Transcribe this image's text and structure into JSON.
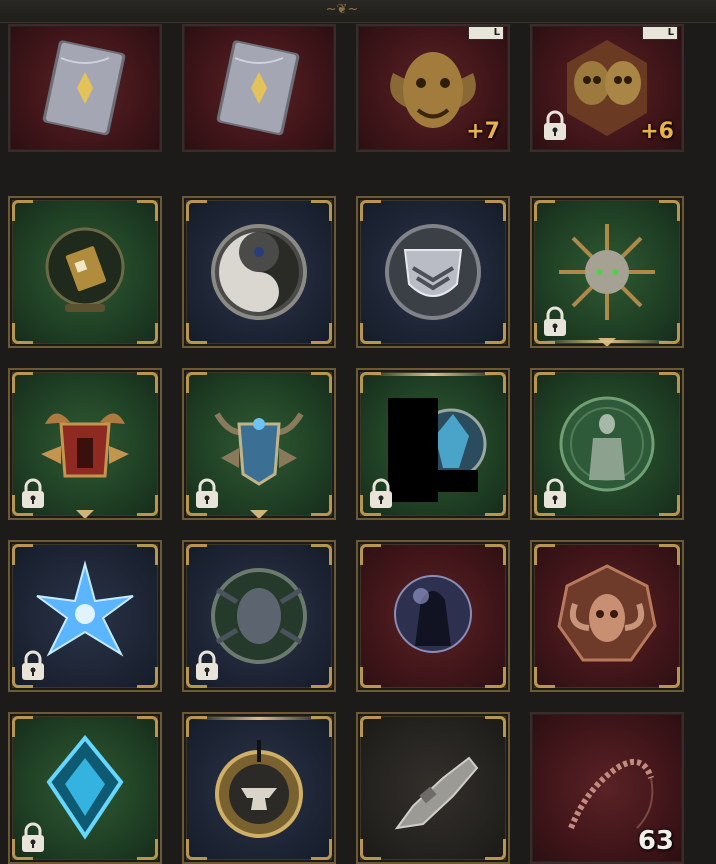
{
  "topbar": {
    "ornament": "~❦~"
  },
  "slots": [
    {
      "id": "book-1",
      "bg": "bg-red",
      "icon": "spellbook-icon",
      "count": "",
      "locked": false,
      "tier_badge": ""
    },
    {
      "id": "book-2",
      "bg": "bg-red",
      "icon": "spellbook-icon",
      "count": "",
      "locked": false,
      "tier_badge": ""
    },
    {
      "id": "ram-demon-head",
      "bg": "bg-red",
      "icon": "ram-demon-head-icon",
      "count": "+7",
      "locked": false,
      "tier_badge": "L"
    },
    {
      "id": "twin-skulls",
      "bg": "bg-red",
      "icon": "twin-skulls-icon",
      "count": "+6",
      "locked": true,
      "tier_badge": "L"
    },
    {
      "id": "crystal-ball-card",
      "bg": "bg-green",
      "icon": "crystal-ball-icon",
      "count": "",
      "locked": false
    },
    {
      "id": "yin-yang-medallion",
      "bg": "bg-navy",
      "icon": "yin-yang-icon",
      "count": "",
      "locked": false
    },
    {
      "id": "wing-shield-medallion",
      "bg": "bg-navy",
      "icon": "winged-shield-icon",
      "count": "",
      "locked": false
    },
    {
      "id": "thorned-mandala",
      "bg": "bg-green",
      "icon": "thorn-mandala-icon",
      "count": "",
      "locked": true
    },
    {
      "id": "horned-red-helm",
      "bg": "bg-green",
      "icon": "horned-helm-icon",
      "count": "",
      "locked": true
    },
    {
      "id": "blue-dragon-crest",
      "bg": "bg-green",
      "icon": "dragon-crest-icon",
      "count": "",
      "locked": true
    },
    {
      "id": "redacted-emblem",
      "bg": "bg-green",
      "icon": "blue-gem-emblem-icon",
      "count": "",
      "locked": true
    },
    {
      "id": "green-statue-medallion",
      "bg": "bg-green",
      "icon": "statue-medallion-icon",
      "count": "",
      "locked": true
    },
    {
      "id": "ice-star",
      "bg": "bg-navy",
      "icon": "ice-star-icon",
      "count": "",
      "locked": true
    },
    {
      "id": "spider-rune",
      "bg": "bg-navy",
      "icon": "spider-rune-icon",
      "count": "",
      "locked": true
    },
    {
      "id": "hooded-orb",
      "bg": "bg-red",
      "icon": "hooded-orb-icon",
      "count": "",
      "locked": false
    },
    {
      "id": "ram-skull-emblem",
      "bg": "bg-red",
      "icon": "ram-skull-icon",
      "count": "",
      "locked": false
    },
    {
      "id": "cyan-crystal-frame",
      "bg": "bg-green",
      "icon": "cyan-crystal-icon",
      "count": "",
      "locked": true
    },
    {
      "id": "anvil-medallion",
      "bg": "bg-navy",
      "icon": "anvil-medallion-icon",
      "count": "",
      "locked": false
    },
    {
      "id": "stone-relic",
      "bg": "bg-dark",
      "icon": "stone-relic-icon",
      "count": "",
      "locked": false
    },
    {
      "id": "bone-whip",
      "bg": "bg-red",
      "icon": "bone-whip-icon",
      "count": "63",
      "locked": false
    }
  ]
}
